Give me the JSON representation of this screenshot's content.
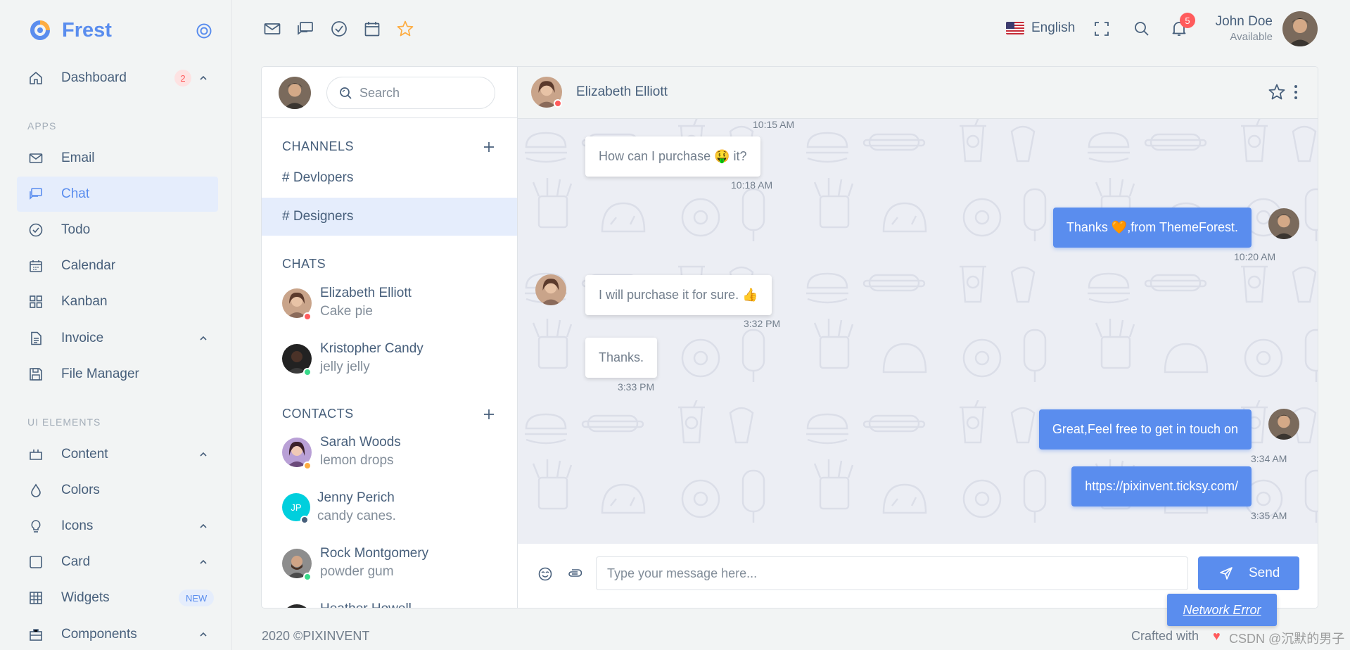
{
  "brand": {
    "name": "Frest"
  },
  "sidebar": {
    "items": [
      {
        "label": "Dashboard",
        "badge": "2"
      },
      {
        "label": "Email"
      },
      {
        "label": "Chat"
      },
      {
        "label": "Todo"
      },
      {
        "label": "Calendar"
      },
      {
        "label": "Kanban"
      },
      {
        "label": "Invoice"
      },
      {
        "label": "File Manager"
      },
      {
        "label": "Content"
      },
      {
        "label": "Colors"
      },
      {
        "label": "Icons"
      },
      {
        "label": "Card"
      },
      {
        "label": "Widgets",
        "badge": "NEW"
      },
      {
        "label": "Components"
      }
    ],
    "sections": {
      "apps": "APPS",
      "ui_elements": "UI ELEMENTS"
    }
  },
  "topbar": {
    "language": "English",
    "notification_count": "5",
    "user_name": "John Doe",
    "user_status": "Available"
  },
  "chat_sidebar": {
    "search_placeholder": "Search",
    "channels_header": "CHANNELS",
    "channels": [
      "# Devlopers",
      "# Designers"
    ],
    "chats_header": "CHATS",
    "chats": [
      {
        "name": "Elizabeth Elliott",
        "message": "Cake pie",
        "status_color": "#ff5b5c"
      },
      {
        "name": "Kristopher Candy",
        "message": "jelly jelly",
        "status_color": "#39da8a"
      }
    ],
    "contacts_header": "CONTACTS",
    "contacts": [
      {
        "name": "Sarah Woods",
        "message": "lemon drops",
        "status_color": "#fdac41"
      },
      {
        "name": "Jenny Perich",
        "message": "candy canes.",
        "initials": "JP",
        "status_color": "#475f7b"
      },
      {
        "name": "Rock Montgomery",
        "message": "powder gum",
        "status_color": "#39da8a"
      },
      {
        "name": "Heather Howell",
        "message": ""
      }
    ]
  },
  "chat": {
    "title": "Elizabeth Elliott",
    "messages": [
      {
        "side": "time",
        "time": "10:15 AM"
      },
      {
        "side": "left",
        "text": "How can I purchase 🤑 it?",
        "time": "10:18 AM"
      },
      {
        "side": "right",
        "text": "Thanks 🧡,from ThemeForest.",
        "time": "10:20 AM"
      },
      {
        "side": "left",
        "text": "I will purchase it for sure. 👍",
        "time": "3:32 PM"
      },
      {
        "side": "left",
        "text": "Thanks.",
        "time": "3:33 PM"
      },
      {
        "side": "right",
        "text": "Great,Feel free to get in touch on",
        "time": "3:34 AM"
      },
      {
        "side": "right",
        "text": "https://pixinvent.ticksy.com/",
        "time": "3:35 AM"
      }
    ],
    "input_placeholder": "Type your message here...",
    "send_label": "Send"
  },
  "footer": {
    "copyright": "2020 ©PIXINVENT",
    "crafted": "Crafted with",
    "network_error": "Network Error",
    "watermark": "CSDN @沉默的男子茶"
  },
  "colors": {
    "primary": "#5a8dee",
    "danger": "#ff5b5c",
    "success": "#39da8a",
    "warning": "#fdac41"
  }
}
